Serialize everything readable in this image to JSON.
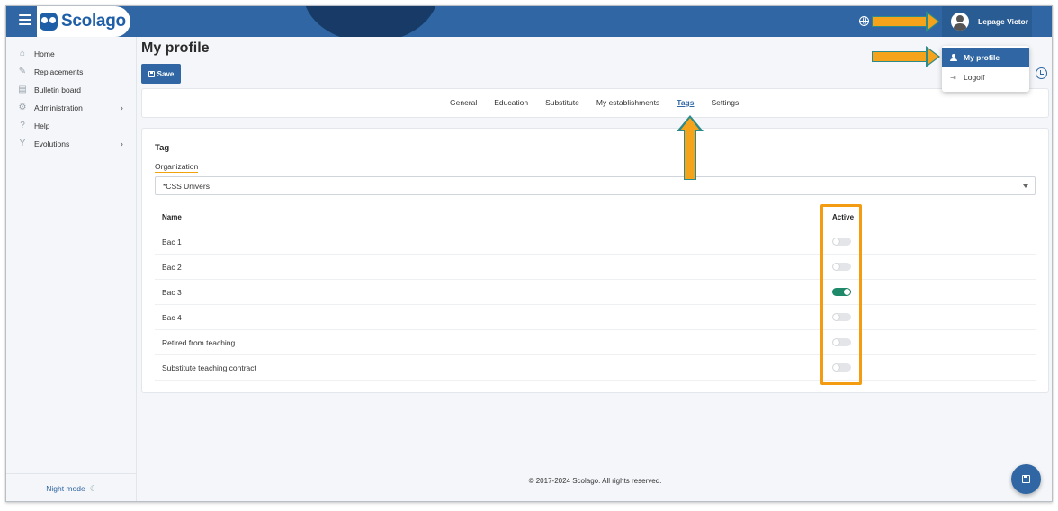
{
  "header": {
    "app_name": "Scolago",
    "user_name": "Lepage Victor"
  },
  "user_menu": {
    "items": [
      {
        "label": "My profile",
        "icon": "person-icon",
        "active": true
      },
      {
        "label": "Logoff",
        "icon": "logoff-icon",
        "active": false
      }
    ]
  },
  "sidebar": {
    "items": [
      {
        "label": "Home",
        "icon": "home-icon",
        "has_submenu": false
      },
      {
        "label": "Replacements",
        "icon": "replacements-icon",
        "has_submenu": false
      },
      {
        "label": "Bulletin board",
        "icon": "bulletin-icon",
        "has_submenu": false
      },
      {
        "label": "Administration",
        "icon": "gear-icon",
        "has_submenu": true
      },
      {
        "label": "Help",
        "icon": "help-icon",
        "has_submenu": false
      },
      {
        "label": "Evolutions",
        "icon": "sprout-icon",
        "has_submenu": true
      }
    ],
    "night_mode_label": "Night mode"
  },
  "page": {
    "title": "My profile",
    "save_label": "Save"
  },
  "tabs": [
    {
      "label": "General",
      "active": false
    },
    {
      "label": "Education",
      "active": false
    },
    {
      "label": "Substitute",
      "active": false
    },
    {
      "label": "My establishments",
      "active": false
    },
    {
      "label": "Tags",
      "active": true
    },
    {
      "label": "Settings",
      "active": false
    }
  ],
  "tag_card": {
    "title": "Tag",
    "organization_label": "Organization",
    "organization_value": "*CSS Univers",
    "columns": {
      "name": "Name",
      "active": "Active"
    },
    "rows": [
      {
        "name": "Bac 1",
        "active": false
      },
      {
        "name": "Bac 2",
        "active": false
      },
      {
        "name": "Bac 3",
        "active": true
      },
      {
        "name": "Bac 4",
        "active": false
      },
      {
        "name": "Retired from teaching",
        "active": false
      },
      {
        "name": "Substitute teaching contract",
        "active": false
      }
    ]
  },
  "footer": {
    "copyright": "© 2017-2024 Scolago. All rights reserved."
  },
  "colors": {
    "primary": "#2f66a3",
    "toggle_on": "#1e8a6a",
    "annotation": "#f39c12"
  }
}
